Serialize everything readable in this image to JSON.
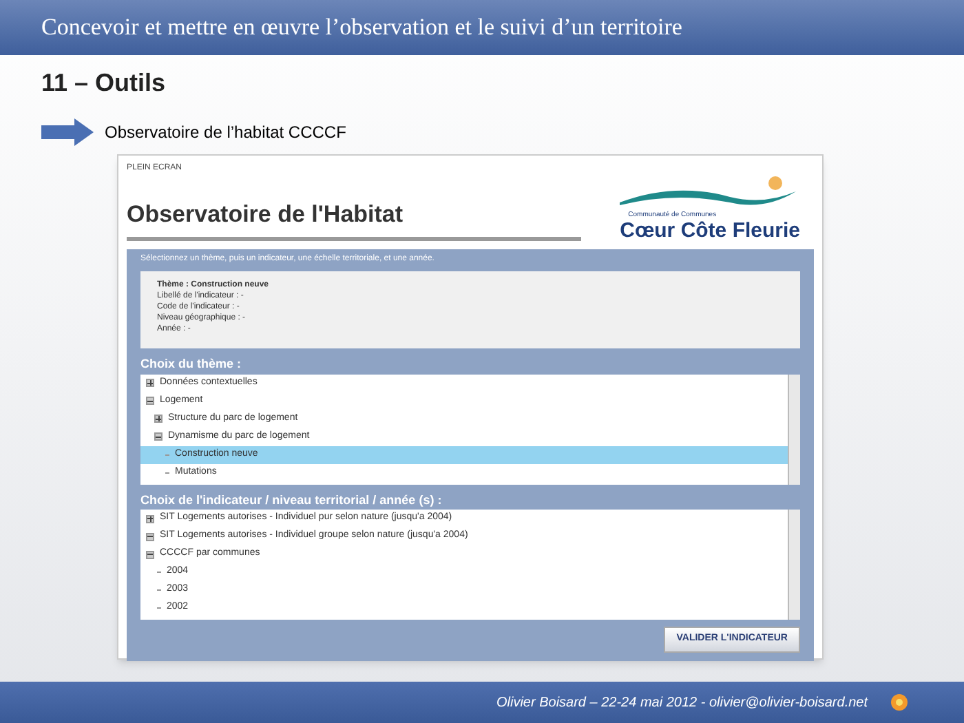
{
  "slide_title": "Concevoir et mettre en œuvre l’observation et le suivi d’un territoire",
  "heading": "11 – Outils",
  "bullet": "Observatoire de l’habitat CCCCF",
  "app": {
    "fullscreen_link": "PLEIN ECRAN",
    "title": "Observatoire de l'Habitat",
    "logo": {
      "subtitle": "Communauté de Communes",
      "name": "Cœur Côte Fleurie"
    },
    "instruction": "Sélectionnez un thème, puis un indicateur, une échelle territoriale, et une année.",
    "summary": [
      {
        "text": "Thème : Construction neuve",
        "bold": true
      },
      {
        "text": "Libellé de l'indicateur : -",
        "bold": false
      },
      {
        "text": "Code de l'indicateur : -",
        "bold": false
      },
      {
        "text": "Niveau géographique : -",
        "bold": false
      },
      {
        "text": "Année : -",
        "bold": false
      }
    ],
    "theme_section": {
      "title": "Choix du thème :",
      "tree": [
        {
          "label": "Données contextuelles",
          "kind": "branch",
          "expanded": false,
          "selected": false
        },
        {
          "label": "Logement",
          "kind": "branch",
          "expanded": true,
          "selected": false,
          "children": [
            {
              "label": "Structure du parc de logement",
              "kind": "branch",
              "expanded": false,
              "selected": false
            },
            {
              "label": "Dynamisme du parc de logement",
              "kind": "branch",
              "expanded": true,
              "selected": false,
              "children": [
                {
                  "label": "Construction neuve",
                  "kind": "leaf",
                  "selected": true
                },
                {
                  "label": "Mutations",
                  "kind": "leaf",
                  "selected": false
                }
              ]
            }
          ]
        }
      ]
    },
    "indicator_section": {
      "title": "Choix de l'indicateur / niveau territorial / année (s) :",
      "tree": [
        {
          "label": "SIT Logements autorises - Individuel pur selon nature (jusqu'a 2004)",
          "kind": "branch",
          "expanded": false,
          "selected": false
        },
        {
          "label": "SIT Logements autorises - Individuel groupe selon nature (jusqu'a 2004)",
          "kind": "branch",
          "expanded": true,
          "selected": false
        },
        {
          "label": "CCCCF par communes",
          "kind": "branch",
          "expanded": true,
          "selected": false,
          "children": [
            {
              "label": "2004",
              "kind": "leaf",
              "selected": false
            },
            {
              "label": "2003",
              "kind": "leaf",
              "selected": false
            },
            {
              "label": "2002",
              "kind": "leaf",
              "selected": false
            }
          ]
        }
      ]
    },
    "validate_button": "VALIDER L'INDICATEUR"
  },
  "footer": "Olivier Boisard – 22-24 mai 2012 - olivier@olivier-boisard.net"
}
